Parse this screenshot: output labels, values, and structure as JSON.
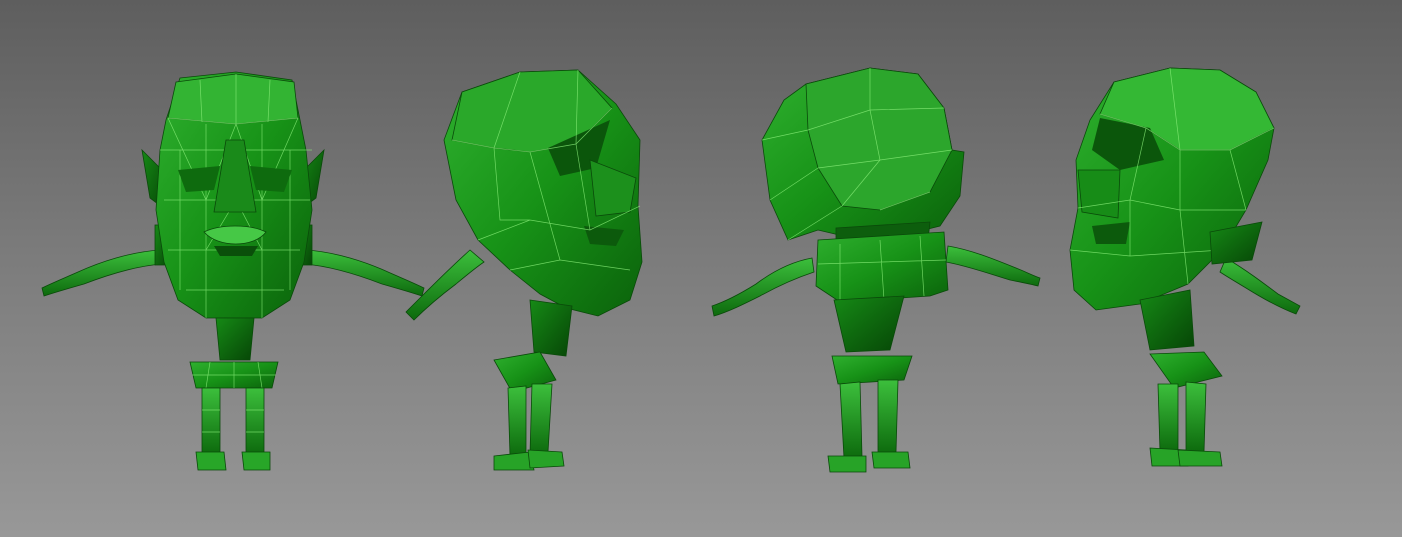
{
  "viewport": {
    "background_top": "#5e5e5e",
    "background_bottom": "#989898",
    "model_color": "#1f9a1f",
    "wire_color": "#8cf07c",
    "shadow_color": "#0c5f0c"
  },
  "views": [
    {
      "name": "front"
    },
    {
      "name": "side-right"
    },
    {
      "name": "back"
    },
    {
      "name": "side-left"
    }
  ]
}
